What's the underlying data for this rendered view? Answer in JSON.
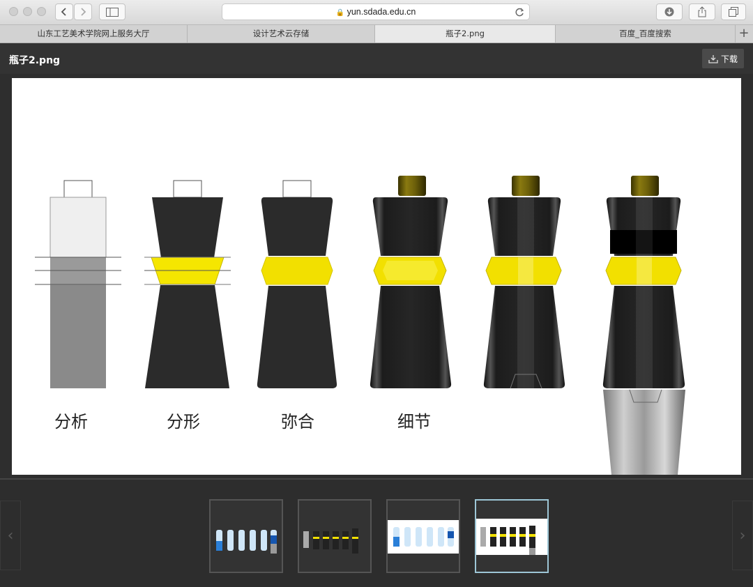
{
  "browser": {
    "url": "yun.sdada.edu.cn",
    "tabs": [
      {
        "label": "山东工艺美术学院网上服务大厅",
        "active": false
      },
      {
        "label": "设计艺术云存储",
        "active": false
      },
      {
        "label": "瓶子2.png",
        "active": true
      },
      {
        "label": "百度_百度搜索",
        "active": false
      }
    ],
    "new_tab": "+"
  },
  "viewer": {
    "file_name": "瓶子2.png",
    "download_label": "下载"
  },
  "image": {
    "labels": [
      "分析",
      "分形",
      "弥合",
      "细节"
    ]
  },
  "thumbnails": {
    "count": 4,
    "active_index": 3
  },
  "colors": {
    "accent_yellow": "#f2e000",
    "bottle_dark": "#2b2b2b",
    "chrome_bg": "#333333",
    "active_thumb": "#9dc6d6"
  }
}
